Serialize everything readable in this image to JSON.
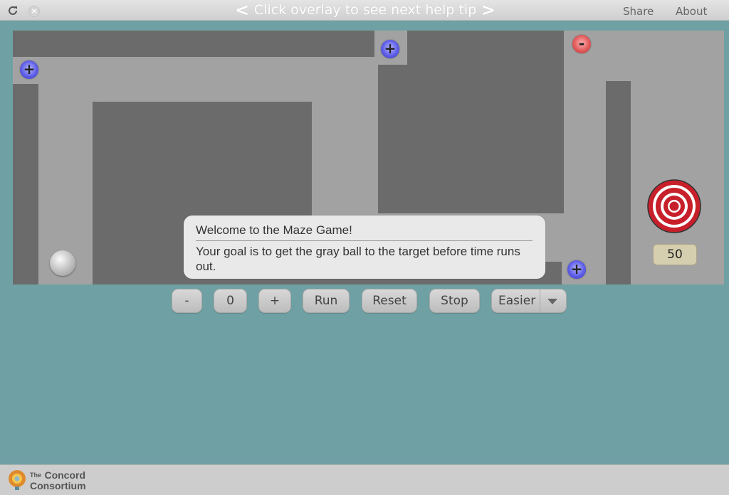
{
  "topbar": {
    "help_tip": "Click overlay to see next help tip",
    "prev": "<",
    "next": ">",
    "share": "Share",
    "about": "About",
    "close_glyph": "×"
  },
  "maze": {
    "charges": [
      {
        "sign": "+",
        "type": "positive",
        "color": "#5e5ee8"
      },
      {
        "sign": "+",
        "type": "positive",
        "color": "#5e5ee8"
      },
      {
        "sign": "-",
        "type": "negative",
        "color": "#e25b5b"
      },
      {
        "sign": "+",
        "type": "positive",
        "color": "#5e5ee8"
      }
    ],
    "timer": "50",
    "target_colors": [
      "#c8202b",
      "#ffffff"
    ]
  },
  "overlay": {
    "title": "Welcome to the Maze Game!",
    "body": "Your goal is to get the gray ball to the target before time runs out."
  },
  "controls": {
    "minus": "-",
    "value": "0",
    "plus": "+",
    "run": "Run",
    "reset": "Reset",
    "stop": "Stop",
    "difficulty": "Easier"
  },
  "footer": {
    "logo_small": "The",
    "logo_line1": "Concord",
    "logo_line2": "Consortium"
  },
  "colors": {
    "background": "#6fa0a3",
    "maze_floor": "#a2a2a2",
    "maze_wall": "#6b6b6b"
  }
}
